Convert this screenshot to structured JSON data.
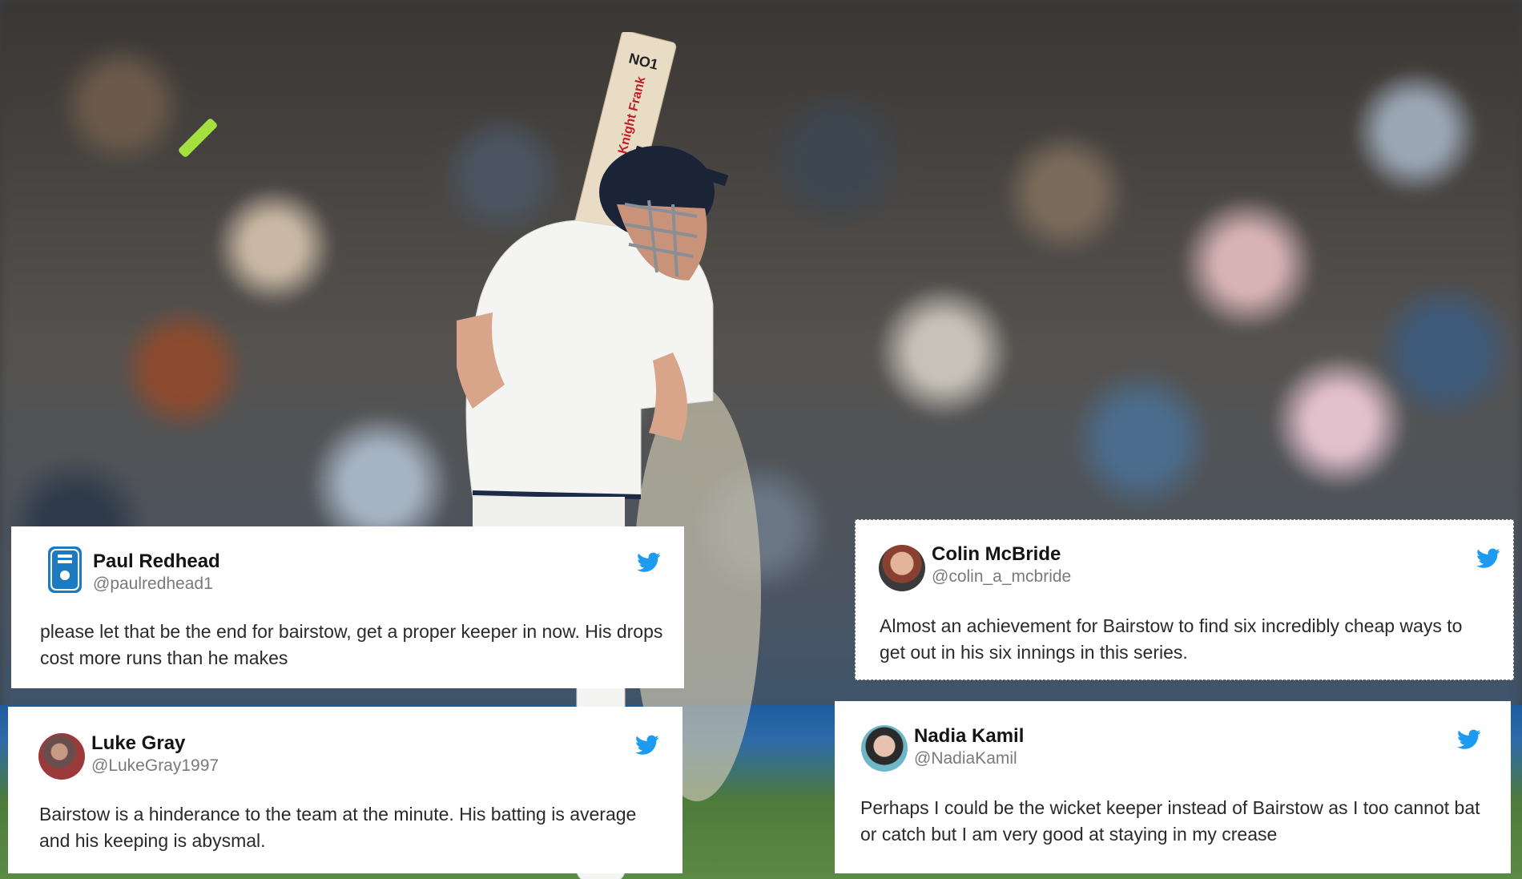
{
  "tweets": [
    {
      "name": "Paul Redhead",
      "handle": "@paulredhead1",
      "text": "please let that be the end for bairstow, get a proper keeper in now. His drops cost more runs than he makes",
      "avatar_icon": "guide-dogs-logo-icon"
    },
    {
      "name": "Colin McBride",
      "handle": "@colin_a_mcbride",
      "text": "Almost an achievement for Bairstow to find six incredibly cheap ways to get out in his six innings in this series.",
      "avatar_icon": "profile-photo-icon"
    },
    {
      "name": "Luke Gray",
      "handle": "@LukeGray1997",
      "text": "Bairstow is a hinderance to the team at the minute. His batting is average and his keeping is abysmal.",
      "avatar_icon": "profile-photo-icon"
    },
    {
      "name": "Nadia Kamil",
      "handle": "@NadiaKamil",
      "text": "Perhaps I could be the wicket keeper instead of Bairstow as I too cannot bat or catch but I am very good at staying in my crease",
      "avatar_icon": "profile-photo-icon"
    }
  ],
  "bat": {
    "brand": "NO1",
    "sponsor": "Knight Frank"
  },
  "colors": {
    "twitter_blue": "#1d9bf0",
    "name": "#141414",
    "handle": "#7a7a7a"
  }
}
